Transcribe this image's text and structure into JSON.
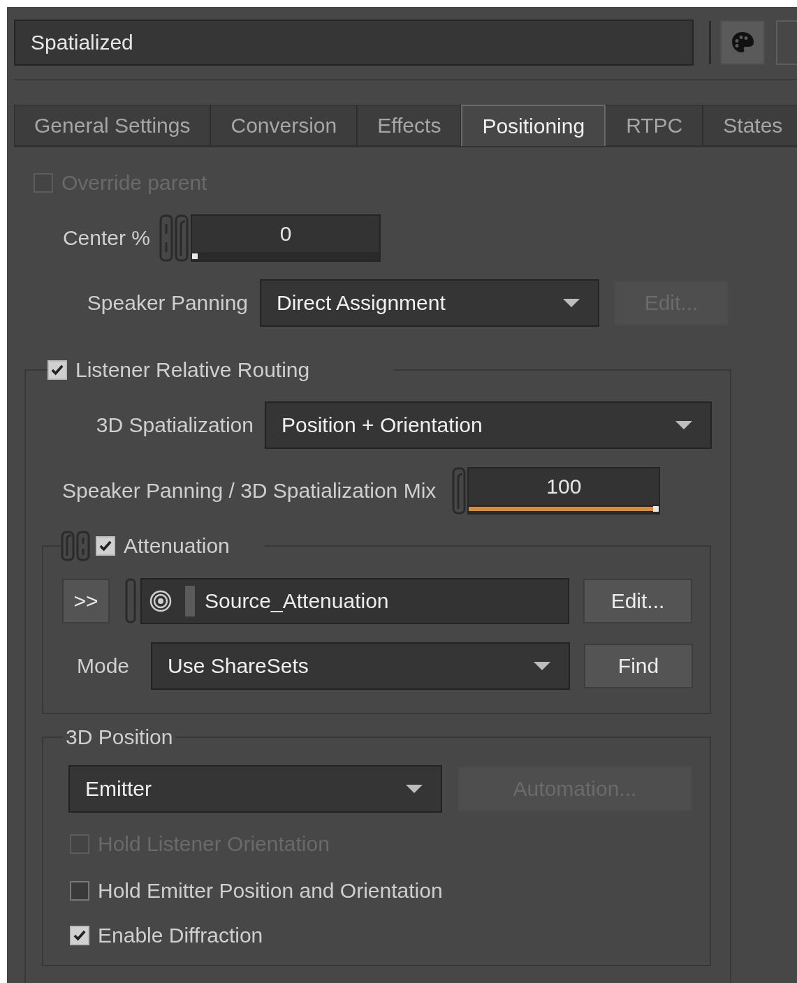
{
  "name_field": {
    "value": "Spatialized"
  },
  "tabs": [
    {
      "label": "General Settings",
      "selected": false
    },
    {
      "label": "Conversion",
      "selected": false
    },
    {
      "label": "Effects",
      "selected": false
    },
    {
      "label": "Positioning",
      "selected": true
    },
    {
      "label": "RTPC",
      "selected": false
    },
    {
      "label": "States",
      "selected": false
    }
  ],
  "override_parent": {
    "label": "Override parent",
    "checked": false,
    "disabled": true
  },
  "center": {
    "label": "Center %",
    "value": "0",
    "level": 0
  },
  "speaker_panning": {
    "label": "Speaker Panning",
    "value": "Direct Assignment",
    "edit_button": {
      "label": "Edit...",
      "disabled": true
    }
  },
  "listener_relative_routing": {
    "label": "Listener Relative Routing",
    "checked": true,
    "spatialization": {
      "label": "3D Spatialization",
      "value": "Position + Orientation"
    },
    "mix": {
      "label": "Speaker Panning / 3D Spatialization Mix",
      "value": "100",
      "level": 1
    },
    "attenuation": {
      "label": "Attenuation",
      "checked": true,
      "expand_button": ">>",
      "shareset": "Source_Attenuation",
      "edit_button": {
        "label": "Edit...",
        "disabled": false
      },
      "mode": {
        "label": "Mode",
        "value": "Use ShareSets"
      },
      "find_button": {
        "label": "Find",
        "disabled": false
      }
    },
    "position": {
      "title": "3D Position",
      "value": "Emitter",
      "automation_button": {
        "label": "Automation...",
        "disabled": true
      },
      "options": [
        {
          "label": "Hold Listener Orientation",
          "checked": false,
          "disabled": true
        },
        {
          "label": "Hold Emitter Position and Orientation",
          "checked": false,
          "disabled": false
        },
        {
          "label": "Enable Diffraction",
          "checked": true,
          "disabled": false
        }
      ]
    }
  }
}
